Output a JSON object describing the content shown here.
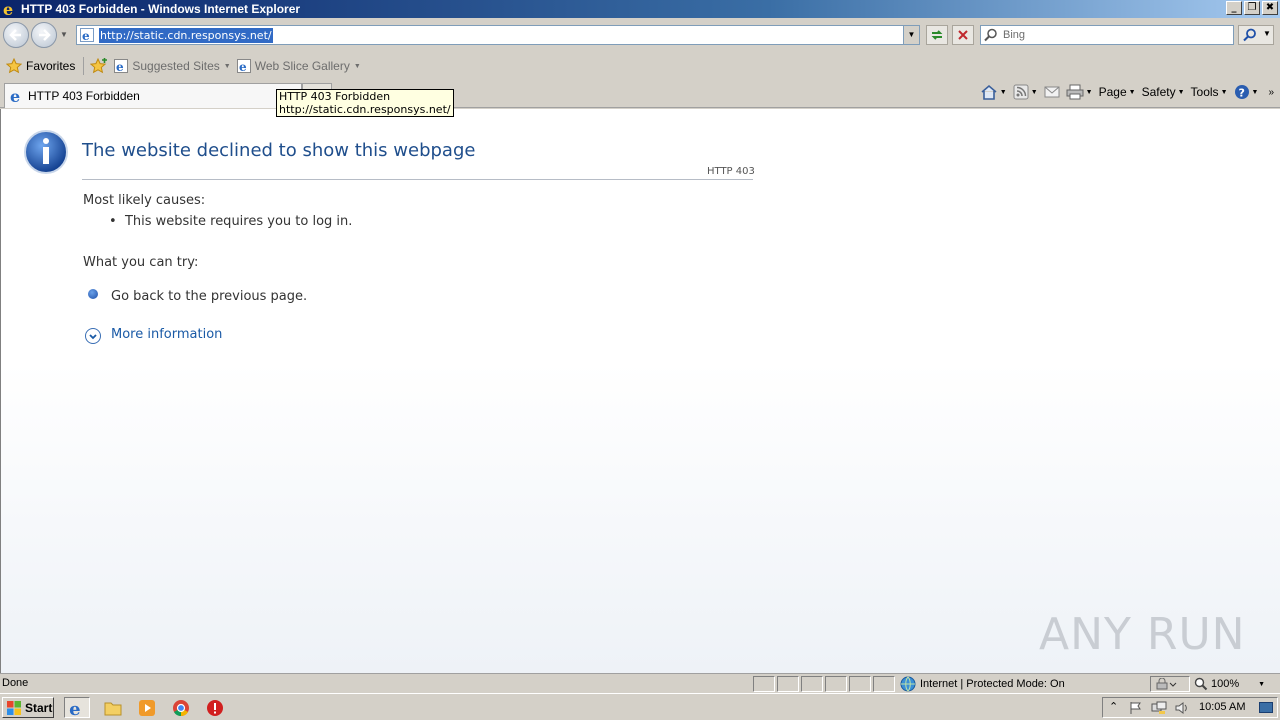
{
  "window": {
    "title": "HTTP 403 Forbidden - Windows Internet Explorer",
    "buttons": [
      "_",
      "❐",
      "✖"
    ]
  },
  "address": {
    "url": "http://static.cdn.responsys.net/"
  },
  "search": {
    "placeholder": "Bing"
  },
  "favorites_bar": {
    "favorites_label": "Favorites",
    "suggested_sites": "Suggested Sites",
    "web_slice_gallery": "Web Slice Gallery"
  },
  "tab": {
    "title": "HTTP 403 Forbidden"
  },
  "tooltip": {
    "line1": "HTTP 403 Forbidden",
    "line2": "http://static.cdn.responsys.net/"
  },
  "commands": {
    "page": "Page",
    "safety": "Safety",
    "tools": "Tools"
  },
  "content": {
    "heading": "The website declined to show this webpage",
    "code": "HTTP 403",
    "causes_heading": "Most likely causes:",
    "cause_1": "This website requires you to log in.",
    "try_heading": "What you can try:",
    "try_1": "Go back to the previous page.",
    "more_info": "More information",
    "watermark": "ANY RUN"
  },
  "status": {
    "text": "Done",
    "zone": "Internet | Protected Mode: On",
    "zoom": "100%"
  },
  "taskbar": {
    "start": "Start",
    "clock": "10:05 AM"
  }
}
